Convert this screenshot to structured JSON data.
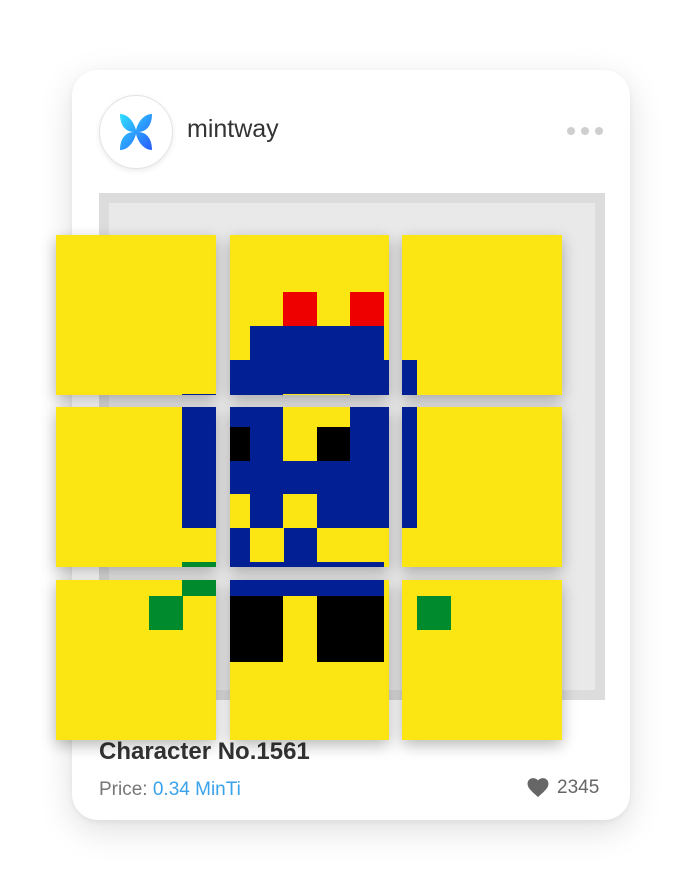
{
  "post": {
    "username": "mintway",
    "avatar_icon": "butterfly-logo-icon",
    "more_icon": "more-dots-icon",
    "title": "Character No.1561",
    "price_label": "Price:",
    "price_value": "0.34 MinTi",
    "likes": "2345",
    "like_icon": "heart-icon"
  },
  "colors": {
    "tile_yellow": "#fbe614",
    "body_blue": "#022094",
    "crown_red": "#ee0000",
    "hand_green": "#008a2e",
    "feet_black": "#000000",
    "price_accent": "#3aa2ea"
  }
}
